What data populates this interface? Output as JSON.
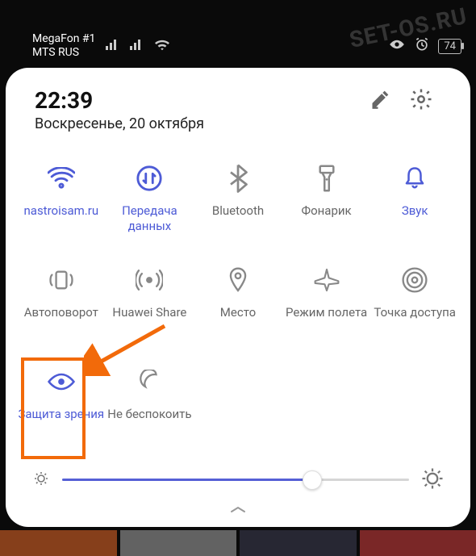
{
  "watermark": "SET-OS.RU",
  "status": {
    "carrier1": "MegaFon #1",
    "carrier2": "MTS RUS",
    "battery": "74"
  },
  "header": {
    "time": "22:39",
    "date": "Воскресенье, 20 октября"
  },
  "tiles": [
    {
      "id": "wifi",
      "label": "nastroisam.ru",
      "active": true
    },
    {
      "id": "mobile-data",
      "label": "Передача данных",
      "active": true
    },
    {
      "id": "bluetooth",
      "label": "Bluetooth",
      "active": false
    },
    {
      "id": "flashlight",
      "label": "Фонарик",
      "active": false
    },
    {
      "id": "sound",
      "label": "Звук",
      "active": true
    },
    {
      "id": "rotate",
      "label": "Автоповорот",
      "active": false
    },
    {
      "id": "hw-share",
      "label": "Huawei Share",
      "active": false
    },
    {
      "id": "location",
      "label": "Место",
      "active": false
    },
    {
      "id": "airplane",
      "label": "Режим полета",
      "active": false
    },
    {
      "id": "hotspot",
      "label": "Точка доступа",
      "active": false
    },
    {
      "id": "eye-comfort",
      "label": "Защита зрения",
      "active": true
    },
    {
      "id": "dnd",
      "label": "Не беспокоить",
      "active": false
    }
  ],
  "brightness": {
    "percent": 72
  },
  "accent": "#4d5bd6",
  "highlight_color": "#f26a0a"
}
